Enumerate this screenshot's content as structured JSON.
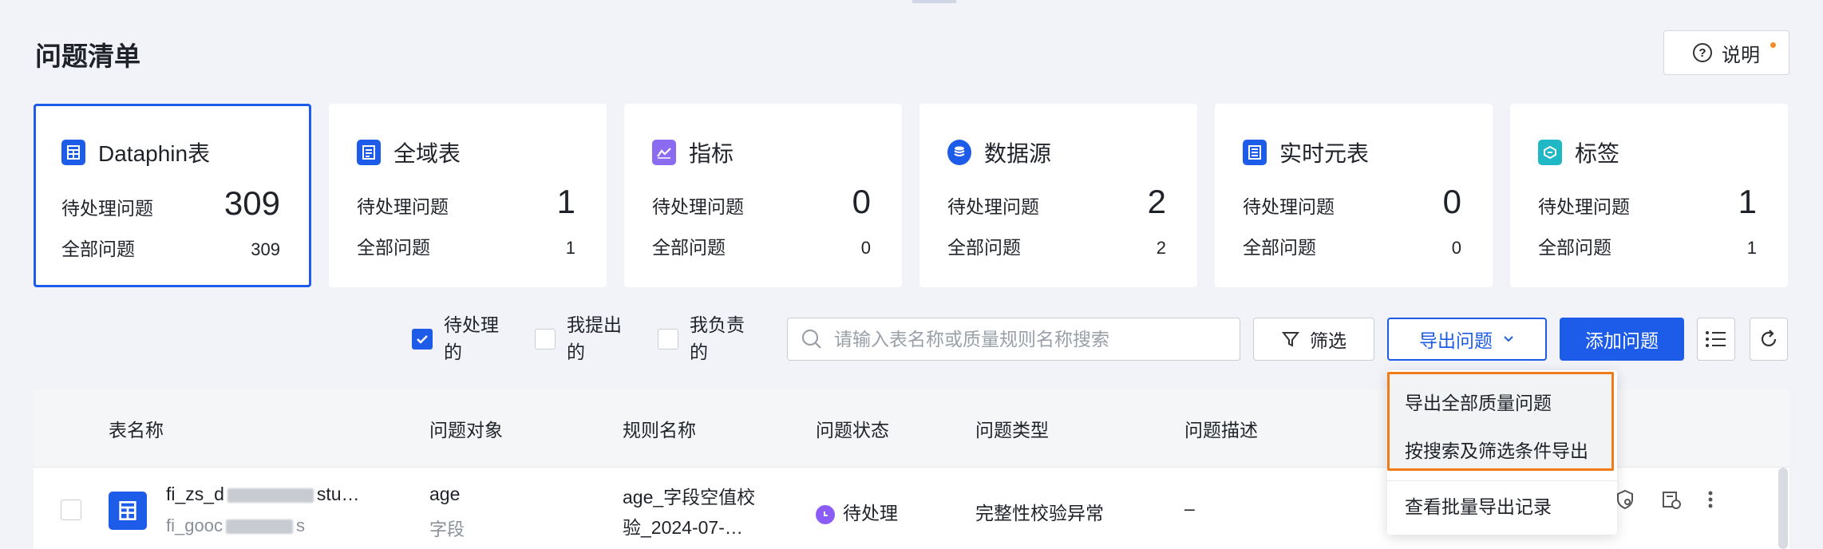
{
  "page": {
    "title": "问题清单",
    "help_label": "说明"
  },
  "cards": [
    {
      "title": "Dataphin表",
      "icon": "table-icon",
      "pending_label": "待处理问题",
      "pending": "309",
      "all_label": "全部问题",
      "all": "309",
      "selected": true,
      "icon_color": "#1d5ce8"
    },
    {
      "title": "全域表",
      "icon": "document-icon",
      "pending_label": "待处理问题",
      "pending": "1",
      "all_label": "全部问题",
      "all": "1",
      "icon_color": "#1d5ce8"
    },
    {
      "title": "指标",
      "icon": "chart-icon",
      "pending_label": "待处理问题",
      "pending": "0",
      "all_label": "全部问题",
      "all": "0",
      "icon_color": "#8b6cf0"
    },
    {
      "title": "数据源",
      "icon": "database-icon",
      "pending_label": "待处理问题",
      "pending": "2",
      "all_label": "全部问题",
      "all": "2",
      "icon_color": "#1d5ce8"
    },
    {
      "title": "实时元表",
      "icon": "realtime-table-icon",
      "pending_label": "待处理问题",
      "pending": "0",
      "all_label": "全部问题",
      "all": "0",
      "icon_color": "#1d5ce8"
    },
    {
      "title": "标签",
      "icon": "tag-icon",
      "pending_label": "待处理问题",
      "pending": "1",
      "all_label": "全部问题",
      "all": "1",
      "icon_color": "#1fb8c4"
    }
  ],
  "filters": {
    "pending": {
      "label": "待处理的",
      "checked": true
    },
    "mine_raised": {
      "label": "我提出的",
      "checked": false
    },
    "mine_responsible": {
      "label": "我负责的",
      "checked": false
    }
  },
  "search": {
    "placeholder": "请输入表名称或质量规则名称搜索",
    "value": ""
  },
  "toolbar": {
    "filter_label": "筛选",
    "export_label": "导出问题",
    "add_label": "添加问题"
  },
  "table": {
    "columns": [
      "表名称",
      "问题对象",
      "规则名称",
      "问题状态",
      "问题类型",
      "问题描述"
    ],
    "rows": [
      {
        "name": "fi_zs_d",
        "name_suffix": "stu…",
        "name_sub": "fi_gooc",
        "name_sub_suffix": "s",
        "object": "age",
        "object_sub": "字段",
        "rule_line1": "age_字段空值校",
        "rule_line2": "验_2024-07-…",
        "status": "待处理",
        "type": "完整性校验异常",
        "description": "–"
      }
    ]
  },
  "export_menu": {
    "items": [
      "导出全部质量问题",
      "按搜索及筛选条件导出",
      "查看批量导出记录"
    ]
  },
  "colors": {
    "primary": "#1d5ce8",
    "highlight": "#f07b1a",
    "status_pending": "#8b5cf6"
  }
}
